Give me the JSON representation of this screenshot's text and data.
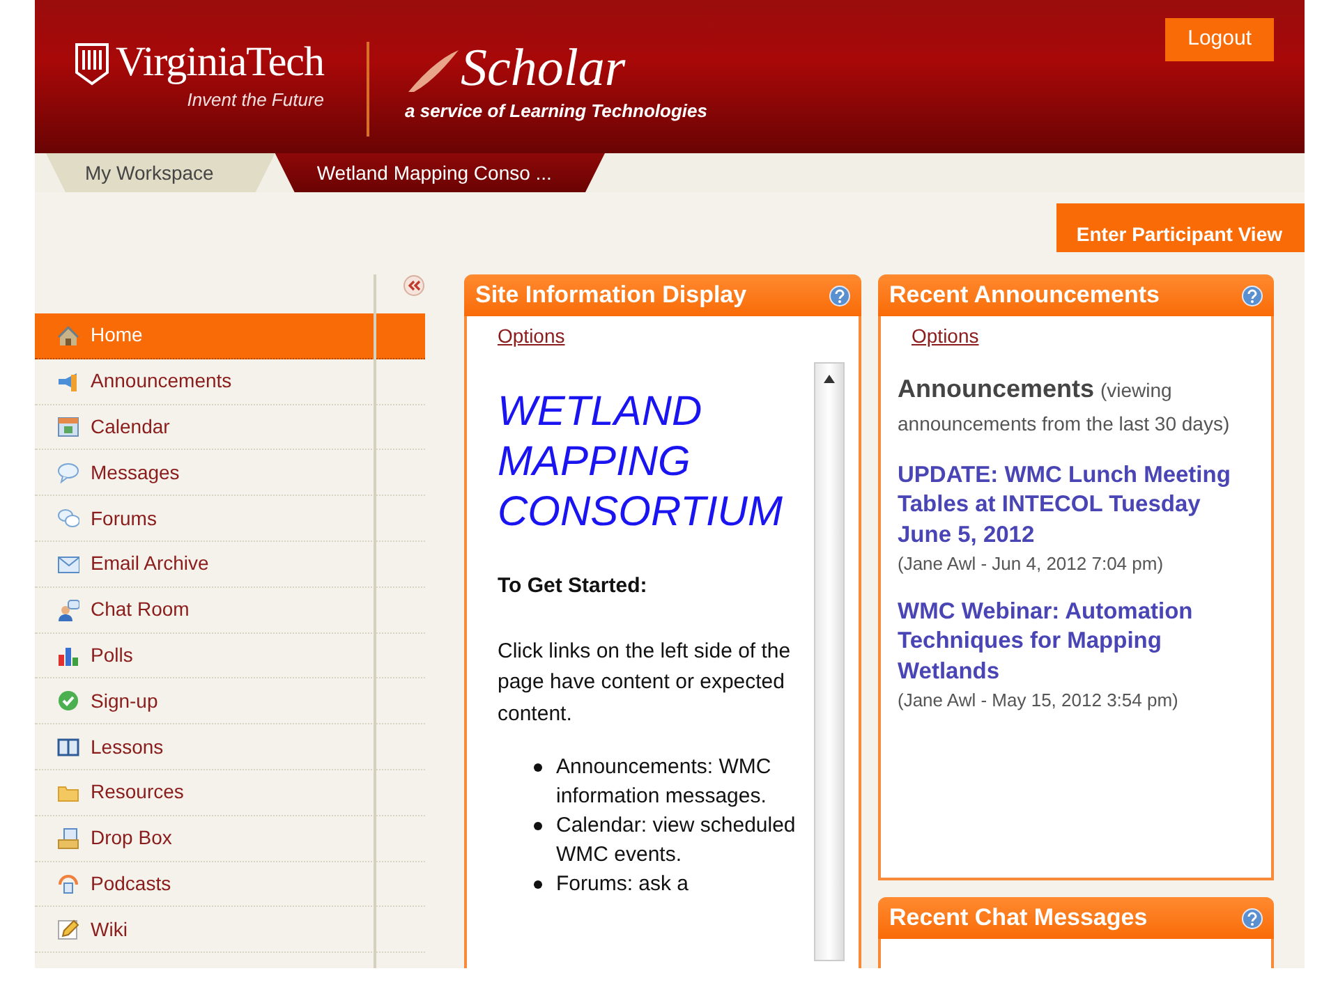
{
  "header": {
    "logo_name": "VirginiaTech",
    "logo_tagline": "Invent the Future",
    "product_name": "Scholar",
    "product_tagline": "a service of Learning Technologies",
    "logout": "Logout"
  },
  "site_tabs": [
    {
      "label": "My Workspace",
      "selected": false
    },
    {
      "label": "Wetland Mapping Conso ...",
      "selected": true
    }
  ],
  "participant_view_button": "Enter Participant View",
  "tool_menu": [
    {
      "label": "Home",
      "selected": true
    },
    {
      "label": "Announcements",
      "selected": false
    },
    {
      "label": "Calendar",
      "selected": false
    },
    {
      "label": "Messages",
      "selected": false
    },
    {
      "label": "Forums",
      "selected": false
    },
    {
      "label": "Email Archive",
      "selected": false
    },
    {
      "label": "Chat Room",
      "selected": false
    },
    {
      "label": "Polls",
      "selected": false
    },
    {
      "label": "Sign-up",
      "selected": false
    },
    {
      "label": "Lessons",
      "selected": false
    },
    {
      "label": "Resources",
      "selected": false
    },
    {
      "label": "Drop Box",
      "selected": false
    },
    {
      "label": "Podcasts",
      "selected": false
    },
    {
      "label": "Wiki",
      "selected": false
    }
  ],
  "columns": [
    [
      {
        "kind": "site_info",
        "title": "Site Information Display",
        "options": "Options",
        "heading": "WETLAND MAPPING CONSORTIUM",
        "subheading": "To Get Started:",
        "paragraph": "Click links on the left side of the page have content or expected content.",
        "bullets": [
          "Announcements: WMC information messages.",
          "Calendar: view scheduled WMC events.",
          "Forums: ask a"
        ]
      }
    ],
    [
      {
        "kind": "announcements",
        "title": "Recent Announcements",
        "options": "Options",
        "heading": "Announcements",
        "heading_note": "(viewing announcements from the last 30 days)",
        "items": [
          {
            "title": "UPDATE: WMC Lunch Meeting Tables at INTECOL Tuesday June 5, 2012",
            "byline": "(Jane Awl - Jun 4, 2012 7:04 pm)"
          },
          {
            "title": "WMC Webinar: Automation Techniques for Mapping Wetlands",
            "byline": "(Jane Awl - May 15, 2012 3:54 pm)"
          }
        ]
      },
      {
        "kind": "chat",
        "title": "Recent Chat Messages"
      }
    ]
  ]
}
